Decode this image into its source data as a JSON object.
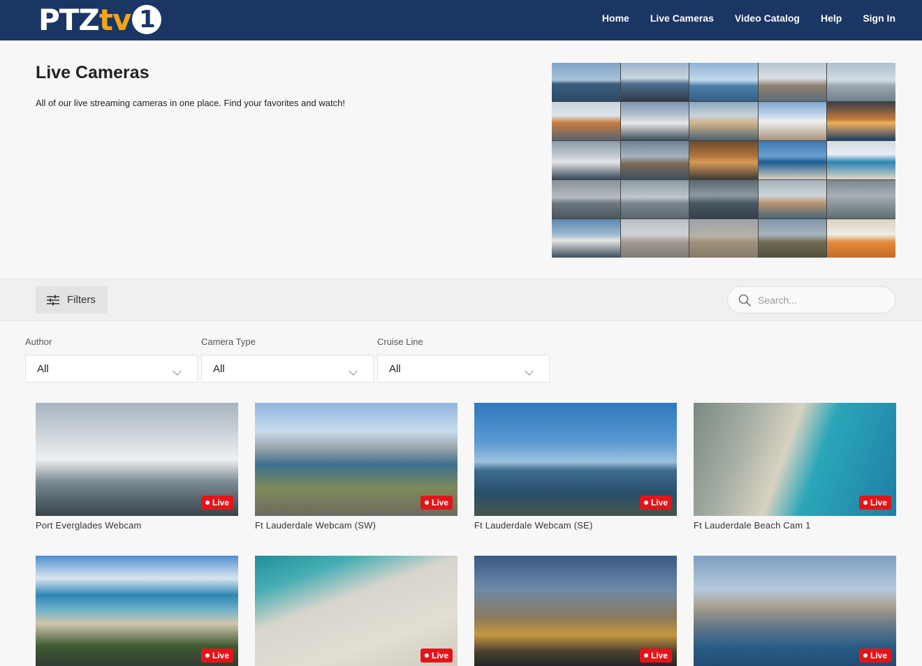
{
  "header": {
    "logo": {
      "part1": "PTZ",
      "part2": "tv",
      "part3": "1"
    },
    "nav": [
      "Home",
      "Live Cameras",
      "Video Catalog",
      "Help",
      "Sign In"
    ]
  },
  "hero": {
    "title": "Live Cameras",
    "subtitle": "All of our live streaming cameras in one place. Find your favorites and watch!"
  },
  "filterbar": {
    "filters_label": "Filters",
    "search_placeholder": "Search..."
  },
  "filters": [
    {
      "label": "Author",
      "value": "All"
    },
    {
      "label": "Camera Type",
      "value": "All"
    },
    {
      "label": "Cruise Line",
      "value": "All"
    }
  ],
  "live_label": "Live",
  "cameras": [
    {
      "title": "Port Everglades Webcam"
    },
    {
      "title": "Ft Lauderdale Webcam (SW)"
    },
    {
      "title": "Ft Lauderdale Webcam (SE)"
    },
    {
      "title": "Ft Lauderdale Beach Cam 1"
    },
    {
      "title": ""
    },
    {
      "title": ""
    },
    {
      "title": ""
    },
    {
      "title": ""
    }
  ]
}
